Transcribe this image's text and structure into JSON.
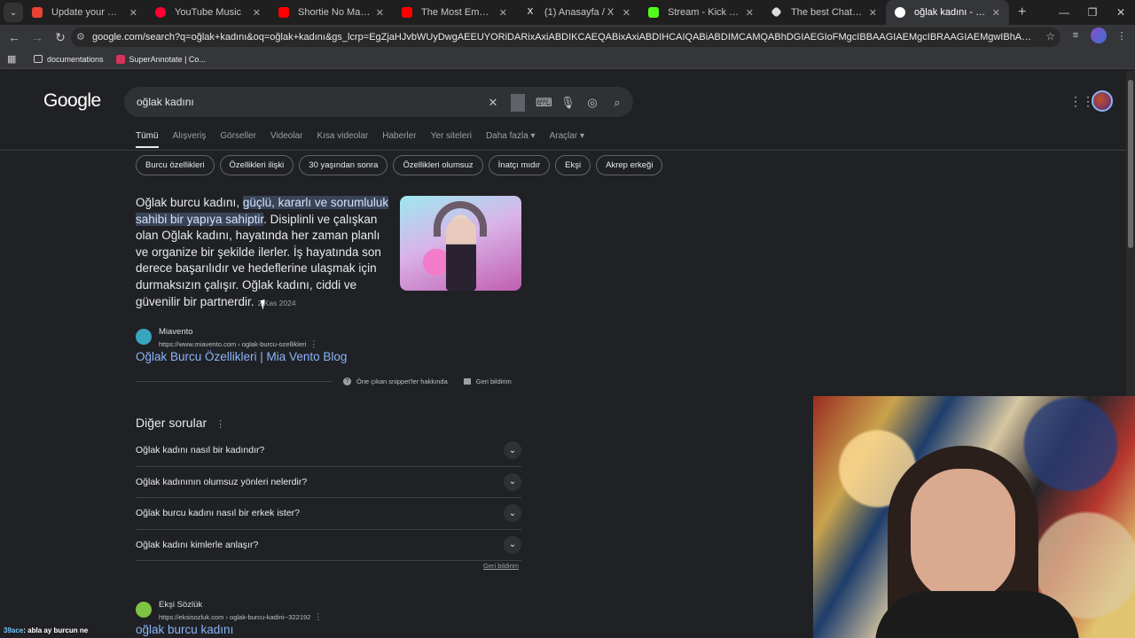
{
  "browser": {
    "tabs": [
      {
        "label": "Update your Workzone p",
        "favicon_color": "#ea4335"
      },
      {
        "label": "YouTube Music",
        "favicon_color": "#ff0033"
      },
      {
        "label": "Shortie No Mass - Like Th",
        "favicon_color": "#ff0000"
      },
      {
        "label": "The Most Embarrassing A",
        "favicon_color": "#ff0000"
      },
      {
        "label": "(1) Anasayfa / X",
        "favicon_color": "#000000"
      },
      {
        "label": "Stream - Kick Dashboard",
        "favicon_color": "#53fc18"
      },
      {
        "label": "The best ChatBot and Wi",
        "favicon_color": "#ffffff"
      },
      {
        "label": "oğlak kadını - Google'da",
        "favicon_color": "#4285f4",
        "active": true
      }
    ],
    "url": "google.com/search?q=oğlak+kadını&oq=oğlak+kadını&gs_lcrp=EgZjaHJvbWUyDwgAEEUYORiDARixAxiABDIKCAEQABixAxiABDIHCAIQABiABDIMCAMQABhDGIAEGIoFMgcIBBAAGIAEMgcIBRAAGIAEMgwIBhAAGEMYgAQYigUyBwgHEAAYgAQyBwgIEAAYgAQy...",
    "bookmarks": [
      "documentations",
      "SuperAnnotate | Co..."
    ]
  },
  "search": {
    "logo": "Google",
    "query": "oğlak kadını",
    "tabs": [
      "Tümü",
      "Alışveriş",
      "Görseller",
      "Videolar",
      "Kısa videolar",
      "Haberler",
      "Yer siteleri",
      "Daha fazla ▾",
      "Araçlar ▾"
    ],
    "chips": [
      "Burcu özellikleri",
      "Özellikleri ilişki",
      "30 yaşından sonra",
      "Özellikleri olumsuz",
      "İnatçı mıdır",
      "Ekşi",
      "Akrep erkeği"
    ]
  },
  "snippet": {
    "prefix": "Oğlak burcu kadını, ",
    "highlight": "güçlü, kararlı ve sorumluluk sahibi bir yapıya sahiptir",
    "rest": ". Disiplinli ve çalışkan olan Oğlak kadını, hayatında her zaman planlı ve organize bir şekilde ilerler. İş hayatında son derece başarılıdır ve hedeflerine ulaşmak için durmaksızın çalışır. Oğlak kadını, ciddi ve güvenilir bir partnerdir.",
    "date": "2 Kas 2024",
    "source_name": "Miavento",
    "source_url": "https://www.miavento.com › oglak-burcu-ozellikleri",
    "title": "Oğlak Burcu Özellikleri | Mia Vento Blog",
    "about_label": "Öne çıkan snippet'ler hakkında",
    "feedback_label": "Geri bildirim"
  },
  "paa": {
    "title": "Diğer sorular",
    "questions": [
      "Oğlak kadını nasıl bir kadındır?",
      "Oğlak kadınının olumsuz yönleri nelerdir?",
      "Oğlak burcu kadını nasıl bir erkek ister?",
      "Oğlak kadını kimlerle anlaşır?"
    ],
    "feedback_label": "Geri bildirim"
  },
  "result2": {
    "source_name": "Ekşi Sözlük",
    "source_url": "https://eksisozluk.com › oglak-burcu-kadini--322192",
    "title": "oğlak burcu kadını"
  },
  "chat": {
    "user": "39ace",
    "message": ": abla ay burcun ne"
  }
}
